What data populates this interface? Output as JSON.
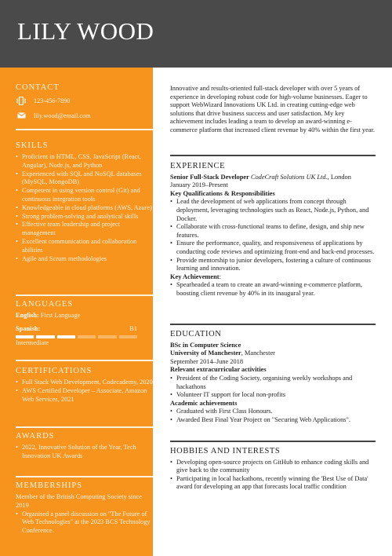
{
  "header": {
    "name": "LILY WOOD"
  },
  "colors": {
    "header_bg": "#4a4a4a",
    "sidebar_bg": "#f7941d",
    "text": "#222222"
  },
  "sidebar": {
    "contact": {
      "title": "CONTACT",
      "phone_icon": "phone-vibrate-icon",
      "phone": "123-456-7890",
      "email_icon": "envelope-icon",
      "email": "lily.wood@email.com"
    },
    "skills": {
      "title": "SKILLS",
      "items": [
        "Proficient in HTML, CSS, JavaScript (React, Angular), Node.js, and Python",
        "Experienced with SQL and NoSQL databases (MySQL, MongoDB)",
        "Competent in using version control (Git) and continuous integration tools",
        "Knowledgeable in cloud platforms (AWS, Azure)",
        "Strong problem-solving and analytical skills",
        "Effective team leadership and project management",
        "Excellent communication and collaboration abilities",
        "Agile and Scrum methodologies"
      ]
    },
    "languages": {
      "title": "LANGUAGES",
      "english_label": "English:",
      "english_level": "First Language",
      "spanish_label": "Spanish:",
      "spanish_code": "B1",
      "spanish_level": "Intermediate",
      "spanish_proficiency": {
        "filled": 3,
        "total": 6
      }
    },
    "certifications": {
      "title": "CERTIFICATIONS",
      "items": [
        "Full Stack Web Development, Codecademy, 2020",
        "AWS Certified Developer – Associate, Amazon Web Services, 2021"
      ]
    },
    "awards": {
      "title": "AWARDS",
      "items": [
        "2022, Innovative Solution of the Year, Tech Innovation UK Awards"
      ]
    },
    "memberships": {
      "title": "MEMBERSHIPS",
      "text": "Member of the British Computing Society since 2019",
      "items": [
        "Organised a panel discussion on \"The Future of Web Technologies\" at the 2023 BCS Technology Conference."
      ]
    }
  },
  "main": {
    "summary": "Innovative and results-oriented full-stack developer with over 5 years of experience in developing robust code for high-volume businesses. Eager to support WebWizard Innovations UK Ltd. in creating cutting-edge web solutions that drive business success and user satisfaction. My key achievement includes leading a team to develop an award-winning e-commerce platform that increased client revenue by 40% within the first year.",
    "experience": {
      "title": "EXPERIENCE",
      "role": "Senior Full-Stack Developer",
      "company": "CodeCraft Solutions UK Ltd.",
      "location": ", London",
      "dates": "January 2019–Present",
      "qual_heading": "Key Qualifications & Responsibilities",
      "responsibilities": [
        "Lead the development of web applications from concept through deployment, leveraging technologies such as React, Node.js, Python, and Docker.",
        "Collaborate with cross-functional teams to define, design, and ship new features.",
        "Ensure the performance, quality, and responsiveness of applications by conducting code reviews and optimizing front-end and back-end processes.",
        "Provide mentorship to junior developers, fostering a culture of continuous learning and innovation."
      ],
      "achievement_heading": "Key Achievement",
      "achievement_colon": ":",
      "achievements": [
        "Spearheaded a team to create an award-winning e-commerce platform, boosting client revenue by 40% in its inaugural year."
      ]
    },
    "education": {
      "title": "EDUCATION",
      "degree": "BSc in Computer Science",
      "school": "University of Manchester",
      "location": ", Manchester",
      "dates": "September 2014–June 2018",
      "extra_heading": "Relevant extracurricular activities",
      "extra_items": [
        "President of the Coding Society, organising weekly workshops and hackathons",
        "Volunteer IT support for local non-profits"
      ],
      "academic_heading": "Academic achievements",
      "academic_items": [
        "Graduated with First Class Honours.",
        "Awarded Best Final Year Project on \"Securing Web Applications\"."
      ]
    },
    "hobbies": {
      "title": "HOBBIES AND INTERESTS",
      "items": [
        "Developing open-source projects on GitHub to enhance coding skills and give back to the community",
        "Participating in local hackathons, recently winning the 'Best Use of Data' award for developing an app that forecasts local traffic condition"
      ]
    }
  }
}
